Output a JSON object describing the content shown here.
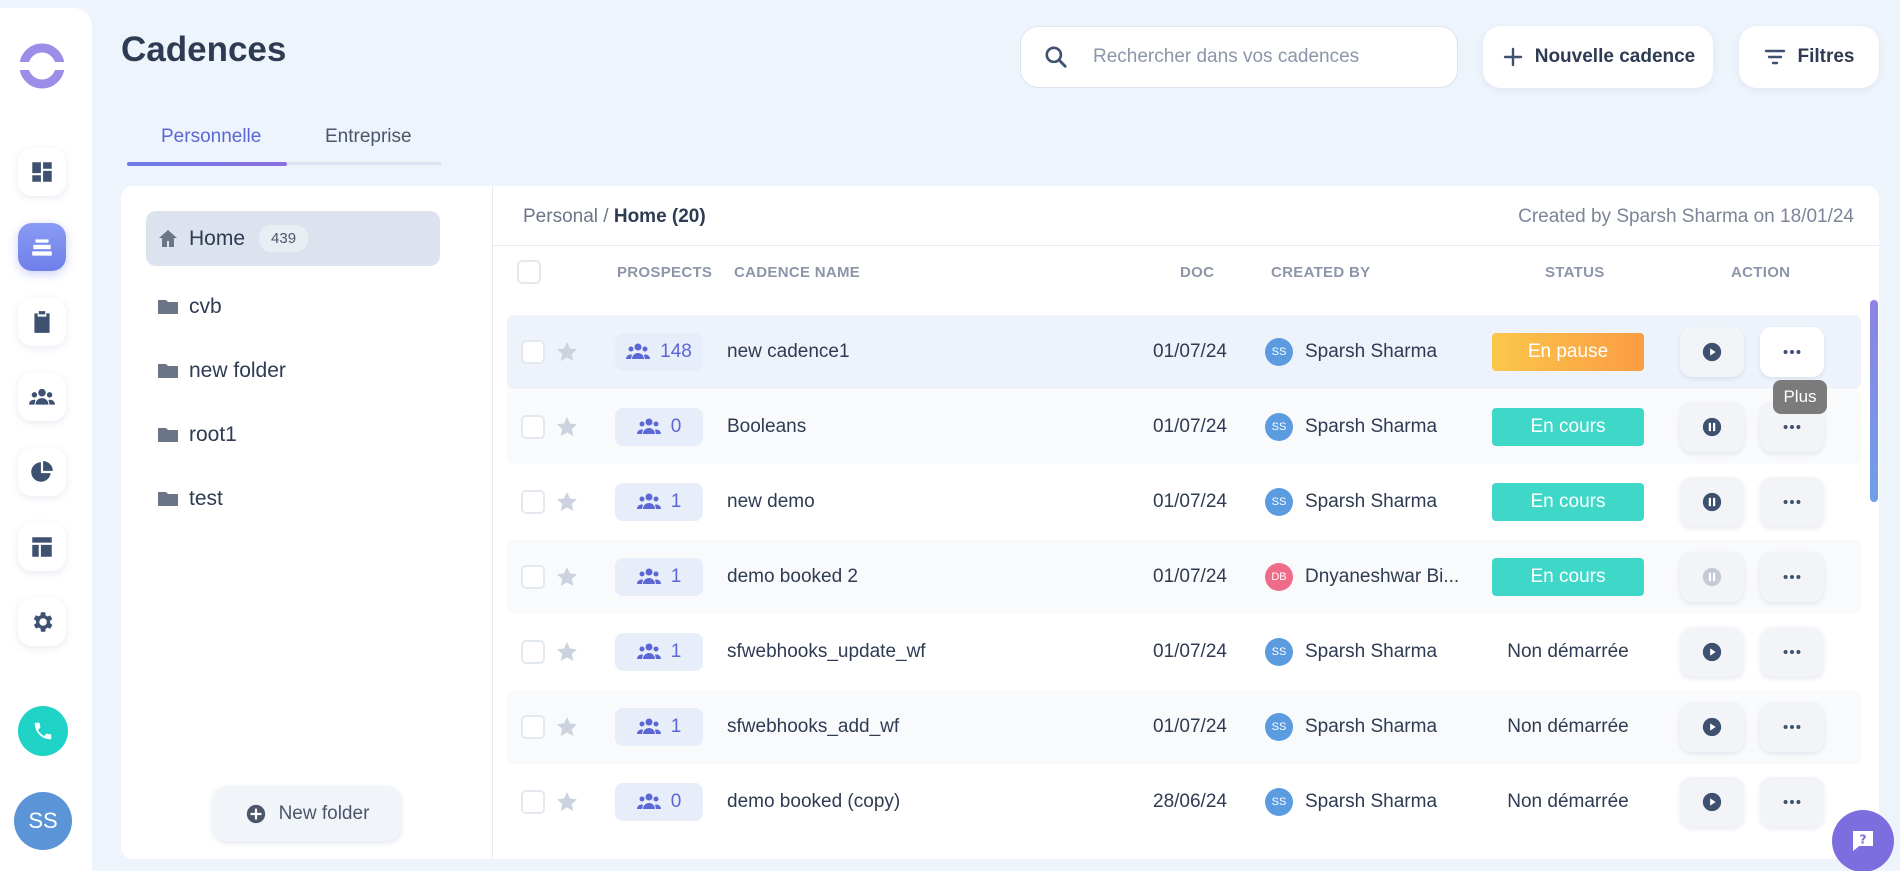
{
  "page": {
    "title": "Cadences"
  },
  "search": {
    "placeholder": "Rechercher dans vos cadences"
  },
  "header": {
    "new_cadence_label": "Nouvelle cadence",
    "filters_label": "Filtres"
  },
  "tabs": [
    {
      "label": "Personnelle",
      "active": true
    },
    {
      "label": "Entreprise",
      "active": false
    }
  ],
  "folders": {
    "home": {
      "label": "Home",
      "count": "439"
    },
    "items": [
      {
        "label": "cvb"
      },
      {
        "label": "new folder"
      },
      {
        "label": "root1"
      },
      {
        "label": "test"
      }
    ],
    "new_folder_label": "New folder"
  },
  "breadcrumb": {
    "root": "Personal",
    "separator": "/",
    "current": "Home (20)"
  },
  "created_info": "Created by Sparsh Sharma on 18/01/24",
  "table": {
    "headers": {
      "prospects": "PROSPECTS",
      "cadence_name": "CADENCE NAME",
      "doc": "DOC",
      "created_by": "CREATED BY",
      "status": "STATUS",
      "action": "ACTION"
    },
    "rows": [
      {
        "prospects": "148",
        "name": "new cadence1",
        "doc": "01/07/24",
        "initials": "SS",
        "creator": "Sparsh Sharma",
        "status": "En pause",
        "status_kind": "paused",
        "action": "play"
      },
      {
        "prospects": "0",
        "name": "Booleans",
        "doc": "01/07/24",
        "initials": "SS",
        "creator": "Sparsh Sharma",
        "status": "En cours",
        "status_kind": "running",
        "action": "pause"
      },
      {
        "prospects": "1",
        "name": "new demo",
        "doc": "01/07/24",
        "initials": "SS",
        "creator": "Sparsh Sharma",
        "status": "En cours",
        "status_kind": "running",
        "action": "pause"
      },
      {
        "prospects": "1",
        "name": "demo booked 2",
        "doc": "01/07/24",
        "initials": "DB",
        "creator": "Dnyaneshwar Bi...",
        "status": "En cours",
        "status_kind": "running",
        "action": "pause-disabled"
      },
      {
        "prospects": "1",
        "name": "sfwebhooks_update_wf",
        "doc": "01/07/24",
        "initials": "SS",
        "creator": "Sparsh Sharma",
        "status": "Non démarrée",
        "status_kind": "not-started",
        "action": "play"
      },
      {
        "prospects": "1",
        "name": "sfwebhooks_add_wf",
        "doc": "01/07/24",
        "initials": "SS",
        "creator": "Sparsh Sharma",
        "status": "Non démarrée",
        "status_kind": "not-started",
        "action": "play"
      },
      {
        "prospects": "0",
        "name": "demo booked (copy)",
        "doc": "28/06/24",
        "initials": "SS",
        "creator": "Sparsh Sharma",
        "status": "Non démarrée",
        "status_kind": "not-started",
        "action": "play"
      }
    ]
  },
  "tooltip": {
    "more": "Plus"
  },
  "user": {
    "initials": "SS"
  },
  "colors": {
    "accent": "#5c67d6",
    "paused": "#fba646",
    "running": "#3fd8c8",
    "avatar_ss": "#5b9be0",
    "avatar_db": "#f06a8a",
    "phone": "#1fd3c6",
    "help": "#7d6ee0"
  }
}
